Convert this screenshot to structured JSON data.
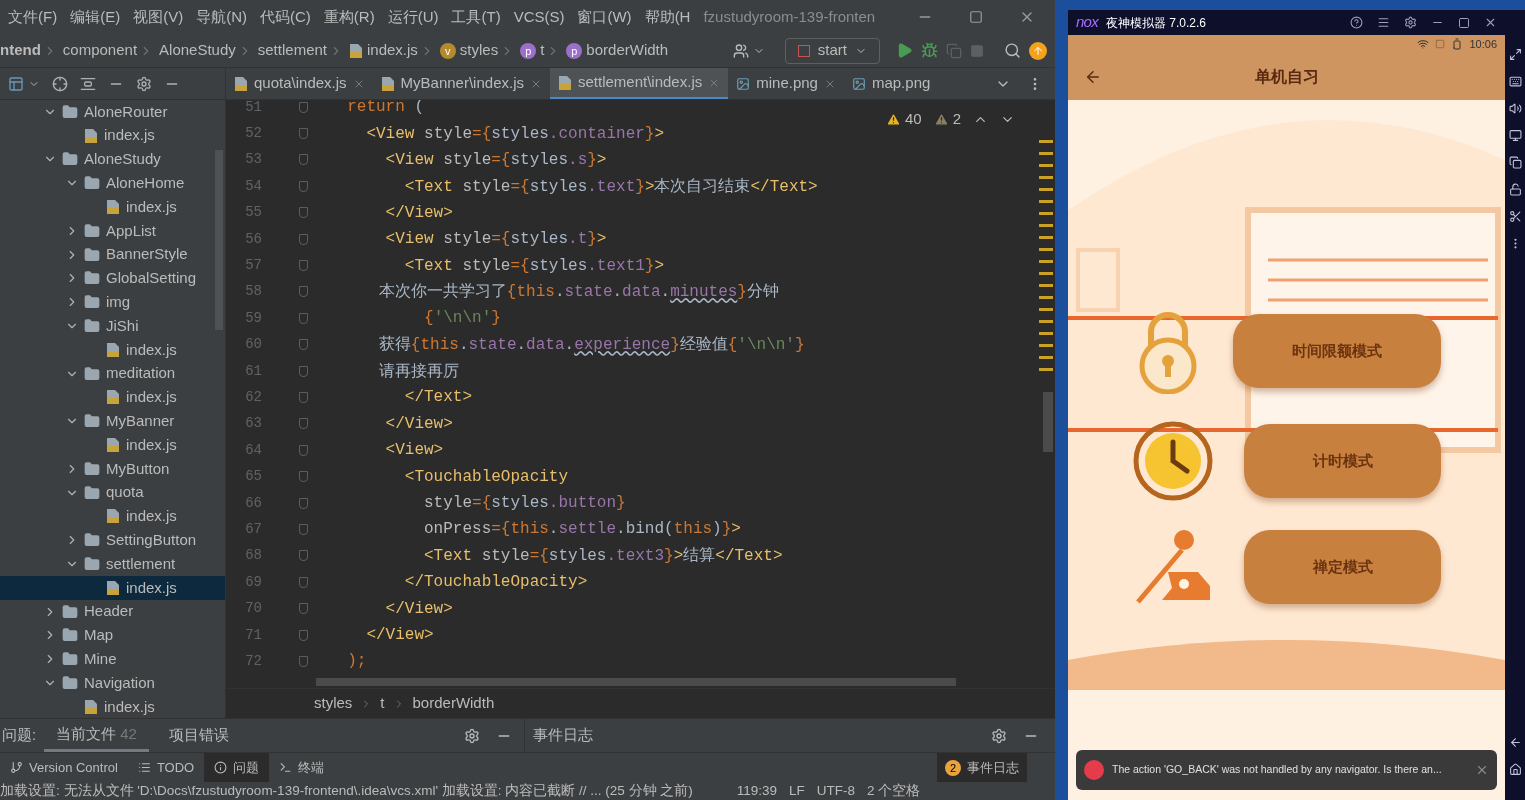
{
  "menu_bar": {
    "items": [
      "文件(F)",
      "编辑(E)",
      "视图(V)",
      "导航(N)",
      "代码(C)",
      "重构(R)",
      "运行(U)",
      "工具(T)",
      "VCS(S)",
      "窗口(W)",
      "帮助(H"
    ],
    "title": "fzustudyroom-139-fronten"
  },
  "navigation_bar": {
    "breadcrumbs": [
      {
        "label": "ntend",
        "kind": "root"
      },
      {
        "label": "component",
        "kind": "folder"
      },
      {
        "label": "AloneStudy",
        "kind": "folder"
      },
      {
        "label": "settlement",
        "kind": "folder"
      },
      {
        "label": "index.js",
        "kind": "js"
      },
      {
        "label": "styles",
        "kind": "symbol",
        "letter": "v",
        "color": "#b48a2c"
      },
      {
        "label": "t",
        "kind": "symbol",
        "letter": "p",
        "color": "#9b70c8"
      },
      {
        "label": "borderWidth",
        "kind": "symbol",
        "letter": "p",
        "color": "#9b70c8"
      }
    ],
    "run_config": "start"
  },
  "editor_tabs": [
    {
      "label": "quota\\index.js",
      "kind": "js",
      "selected": false
    },
    {
      "label": "MyBanner\\index.js",
      "kind": "js",
      "selected": false
    },
    {
      "label": "settlement\\index.js",
      "kind": "js",
      "selected": true
    },
    {
      "label": "mine.png",
      "kind": "image",
      "selected": false
    },
    {
      "label": "map.png",
      "kind": "image",
      "selected": false
    }
  ],
  "project_tree": [
    {
      "label": "AloneRouter",
      "kind": "folder",
      "expanded": true,
      "children": [
        {
          "label": "index.js",
          "kind": "js",
          "selected": false
        }
      ]
    },
    {
      "label": "AloneStudy",
      "kind": "folder",
      "expanded": true,
      "children": [
        {
          "label": "AloneHome",
          "kind": "folder",
          "expanded": true,
          "children": [
            {
              "label": "index.js",
              "kind": "js",
              "selected": false
            }
          ]
        },
        {
          "label": "AppList",
          "kind": "folder",
          "expanded": false
        },
        {
          "label": "BannerStyle",
          "kind": "folder",
          "expanded": false
        },
        {
          "label": "GlobalSetting",
          "kind": "folder",
          "expanded": false
        },
        {
          "label": "img",
          "kind": "folder",
          "expanded": false
        },
        {
          "label": "JiShi",
          "kind": "folder",
          "expanded": true,
          "children": [
            {
              "label": "index.js",
              "kind": "js",
              "selected": false
            }
          ]
        },
        {
          "label": "meditation",
          "kind": "folder",
          "expanded": true,
          "children": [
            {
              "label": "index.js",
              "kind": "js",
              "selected": false
            }
          ]
        },
        {
          "label": "MyBanner",
          "kind": "folder",
          "expanded": true,
          "children": [
            {
              "label": "index.js",
              "kind": "js",
              "selected": false
            }
          ]
        },
        {
          "label": "MyButton",
          "kind": "folder",
          "expanded": false
        },
        {
          "label": "quota",
          "kind": "folder",
          "expanded": true,
          "children": [
            {
              "label": "index.js",
              "kind": "js",
              "selected": false
            }
          ]
        },
        {
          "label": "SettingButton",
          "kind": "folder",
          "expanded": false
        },
        {
          "label": "settlement",
          "kind": "folder",
          "expanded": true,
          "children": [
            {
              "label": "index.js",
              "kind": "js",
              "selected": true
            }
          ]
        }
      ]
    },
    {
      "label": "Header",
      "kind": "folder",
      "expanded": false
    },
    {
      "label": "Map",
      "kind": "folder",
      "expanded": false
    },
    {
      "label": "Mine",
      "kind": "folder",
      "expanded": false
    },
    {
      "label": "Navigation",
      "kind": "folder",
      "expanded": true,
      "children": [
        {
          "label": "index.js",
          "kind": "js",
          "selected": false
        }
      ]
    }
  ],
  "editor": {
    "warnings": "40",
    "weak_warnings": "2",
    "lines": [
      {
        "number": "51",
        "segments": [
          {
            "kind": "kw",
            "text": "  return"
          },
          {
            "kind": "plain",
            "text": " ("
          }
        ]
      },
      {
        "number": "52",
        "segments": [
          {
            "kind": "tag",
            "text": "    <View"
          },
          {
            "kind": "attr",
            "text": " style"
          },
          {
            "kind": "kw",
            "text": "={"
          },
          {
            "kind": "plain",
            "text": "styles"
          },
          {
            "kind": "prop",
            "text": ".container"
          },
          {
            "kind": "kw",
            "text": "}"
          },
          {
            "kind": "tag",
            "text": ">"
          }
        ]
      },
      {
        "number": "53",
        "segments": [
          {
            "kind": "tag",
            "text": "      <View"
          },
          {
            "kind": "attr",
            "text": " style"
          },
          {
            "kind": "kw",
            "text": "={"
          },
          {
            "kind": "plain",
            "text": "styles"
          },
          {
            "kind": "prop",
            "text": ".s"
          },
          {
            "kind": "kw",
            "text": "}"
          },
          {
            "kind": "tag",
            "text": ">"
          }
        ]
      },
      {
        "number": "54",
        "segments": [
          {
            "kind": "tag",
            "text": "        <Text"
          },
          {
            "kind": "attr",
            "text": " style"
          },
          {
            "kind": "kw",
            "text": "={"
          },
          {
            "kind": "plain",
            "text": "styles"
          },
          {
            "kind": "prop",
            "text": ".text"
          },
          {
            "kind": "kw",
            "text": "}"
          },
          {
            "kind": "tag",
            "text": ">"
          },
          {
            "kind": "cjk",
            "text": "本次自习结束"
          },
          {
            "kind": "tag",
            "text": "</Text>"
          }
        ]
      },
      {
        "number": "55",
        "segments": [
          {
            "kind": "tag",
            "text": "      </View>"
          }
        ]
      },
      {
        "number": "56",
        "segments": [
          {
            "kind": "tag",
            "text": "      <View"
          },
          {
            "kind": "attr",
            "text": " style"
          },
          {
            "kind": "kw",
            "text": "={"
          },
          {
            "kind": "plain",
            "text": "styles"
          },
          {
            "kind": "prop",
            "text": ".t"
          },
          {
            "kind": "kw",
            "text": "}"
          },
          {
            "kind": "tag",
            "text": ">"
          }
        ]
      },
      {
        "number": "57",
        "segments": [
          {
            "kind": "tag",
            "text": "        <Text"
          },
          {
            "kind": "attr",
            "text": " style"
          },
          {
            "kind": "kw",
            "text": "={"
          },
          {
            "kind": "plain",
            "text": "styles"
          },
          {
            "kind": "prop",
            "text": ".text1"
          },
          {
            "kind": "kw",
            "text": "}"
          },
          {
            "kind": "tag",
            "text": ">"
          }
        ]
      },
      {
        "number": "58",
        "segments": [
          {
            "kind": "cjk",
            "text": "          本次你一共学习了"
          },
          {
            "kind": "kw",
            "text": "{this"
          },
          {
            "kind": "plain",
            "text": "."
          },
          {
            "kind": "prop",
            "text": "state"
          },
          {
            "kind": "plain",
            "text": "."
          },
          {
            "kind": "prop",
            "text": "data"
          },
          {
            "kind": "plain",
            "text": "."
          },
          {
            "kind": "warn",
            "text": "minutes"
          },
          {
            "kind": "kw",
            "text": "}"
          },
          {
            "kind": "cjk",
            "text": "分钟"
          }
        ]
      },
      {
        "number": "59",
        "segments": [
          {
            "kind": "kw",
            "text": "          {"
          },
          {
            "kind": "str",
            "text": "'\\n\\n'"
          },
          {
            "kind": "kw",
            "text": "}"
          }
        ]
      },
      {
        "number": "60",
        "segments": [
          {
            "kind": "cjk",
            "text": "          获得"
          },
          {
            "kind": "kw",
            "text": "{this"
          },
          {
            "kind": "plain",
            "text": "."
          },
          {
            "kind": "prop",
            "text": "state"
          },
          {
            "kind": "plain",
            "text": "."
          },
          {
            "kind": "prop",
            "text": "data"
          },
          {
            "kind": "plain",
            "text": "."
          },
          {
            "kind": "warn",
            "text": "experience"
          },
          {
            "kind": "kw",
            "text": "}"
          },
          {
            "kind": "cjk",
            "text": "经验值"
          },
          {
            "kind": "kw",
            "text": "{"
          },
          {
            "kind": "str",
            "text": "'\\n\\n'"
          },
          {
            "kind": "kw",
            "text": "}"
          }
        ]
      },
      {
        "number": "61",
        "segments": [
          {
            "kind": "cjk",
            "text": "          请再接再厉"
          }
        ]
      },
      {
        "number": "62",
        "segments": [
          {
            "kind": "tag",
            "text": "        </Text>"
          }
        ]
      },
      {
        "number": "63",
        "segments": [
          {
            "kind": "tag",
            "text": "      </View>"
          }
        ]
      },
      {
        "number": "64",
        "segments": [
          {
            "kind": "tag",
            "text": "      <View>"
          }
        ]
      },
      {
        "number": "65",
        "segments": [
          {
            "kind": "tag",
            "text": "        <TouchableOpacity"
          }
        ]
      },
      {
        "number": "66",
        "segments": [
          {
            "kind": "attr",
            "text": "          style"
          },
          {
            "kind": "kw",
            "text": "={"
          },
          {
            "kind": "plain",
            "text": "styles"
          },
          {
            "kind": "prop",
            "text": ".button"
          },
          {
            "kind": "kw",
            "text": "}"
          }
        ]
      },
      {
        "number": "67",
        "segments": [
          {
            "kind": "attr",
            "text": "          onPress"
          },
          {
            "kind": "kw",
            "text": "={this"
          },
          {
            "kind": "plain",
            "text": "."
          },
          {
            "kind": "prop",
            "text": "settle"
          },
          {
            "kind": "plain",
            "text": ".bind("
          },
          {
            "kind": "kw",
            "text": "this"
          },
          {
            "kind": "plain",
            "text": ")"
          },
          {
            "kind": "kw",
            "text": "}"
          },
          {
            "kind": "tag",
            "text": ">"
          }
        ]
      },
      {
        "number": "68",
        "segments": [
          {
            "kind": "tag",
            "text": "          <Text"
          },
          {
            "kind": "attr",
            "text": " style"
          },
          {
            "kind": "kw",
            "text": "={"
          },
          {
            "kind": "plain",
            "text": "styles"
          },
          {
            "kind": "prop",
            "text": ".text3"
          },
          {
            "kind": "kw",
            "text": "}"
          },
          {
            "kind": "tag",
            "text": ">"
          },
          {
            "kind": "cjk",
            "text": "结算"
          },
          {
            "kind": "tag",
            "text": "</Text>"
          }
        ]
      },
      {
        "number": "69",
        "segments": [
          {
            "kind": "tag",
            "text": "        </TouchableOpacity>"
          }
        ]
      },
      {
        "number": "70",
        "segments": [
          {
            "kind": "tag",
            "text": "      </View>"
          }
        ]
      },
      {
        "number": "71",
        "segments": [
          {
            "kind": "tag",
            "text": "    </View>"
          }
        ]
      },
      {
        "number": "72",
        "segments": [
          {
            "kind": "kw",
            "text": "  );"
          }
        ]
      }
    ]
  },
  "editor_breadcrumbs": [
    "styles",
    "t",
    "borderWidth"
  ],
  "problems_panel": {
    "label": "问题:",
    "tabs": [
      {
        "label": "当前文件",
        "count": "42",
        "selected": true
      },
      {
        "label": "项目错误",
        "selected": false
      }
    ]
  },
  "event_log_panel": {
    "title": "事件日志"
  },
  "tool_window_bar": {
    "items": [
      {
        "label": "Version Control",
        "kind": "vcs",
        "selected": false
      },
      {
        "label": "TODO",
        "kind": "list",
        "selected": false
      },
      {
        "label": "问题",
        "kind": "info",
        "selected": true
      },
      {
        "label": "终端",
        "kind": "terminal",
        "selected": false
      }
    ],
    "event_log": {
      "label": "事件日志",
      "badge": "2"
    }
  },
  "status_bar": {
    "message": "加载设置: 无法从文件 'D:\\Docs\\fzustudyroom-139-frontend\\.idea\\vcs.xml' 加载设置: 内容已截断 // ... (25 分钟 之前)",
    "position": "119:39",
    "line_separator": "LF",
    "encoding": "UTF-8",
    "indent": "2 个空格"
  },
  "emulator": {
    "logo": "nox",
    "title": "夜神模拟器 7.0.2.6",
    "status_time": "10:06",
    "app_title": "单机自习",
    "mode_buttons": [
      {
        "label": "时间限额模式",
        "kind": "lock"
      },
      {
        "label": "计时模式",
        "kind": "clock"
      },
      {
        "label": "禅定模式",
        "kind": "meditate"
      }
    ],
    "toast": "The action 'GO_BACK' was not handled by any navigator. Is there an..."
  }
}
